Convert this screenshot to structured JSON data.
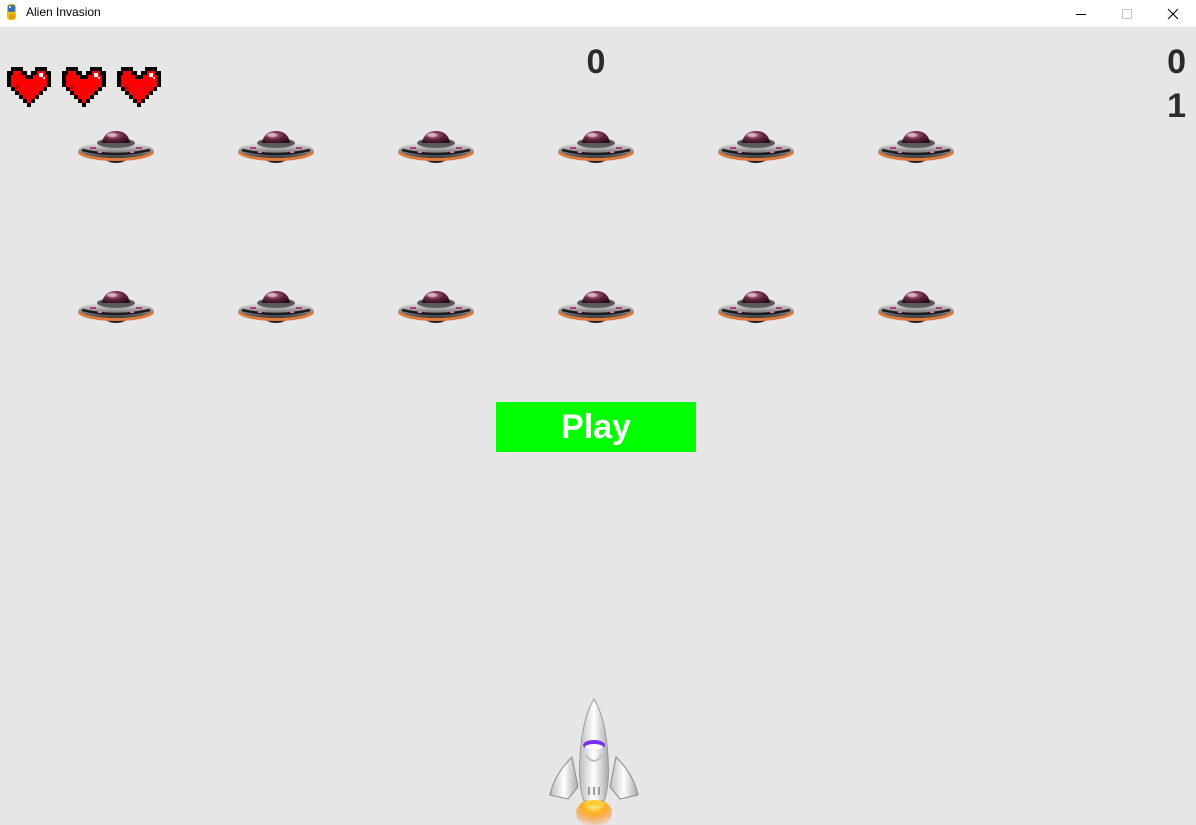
{
  "window": {
    "title": "Alien Invasion",
    "app_icon": "python-snake-icon",
    "controls": [
      "minimize-icon",
      "maximize-icon",
      "close-icon"
    ]
  },
  "game": {
    "score": "0",
    "high_score": "0",
    "level": "1",
    "lives": 3,
    "ships_left_icon": "heart-icon",
    "alien_rows": 2,
    "aliens_per_row": 6,
    "alien_icon": "ufo-icon",
    "player_icon": "spaceship-icon",
    "play_button": {
      "label": "Play",
      "background": "#00ff00",
      "text_color": "#ffffff"
    },
    "background_color": "#e6e6e6"
  }
}
